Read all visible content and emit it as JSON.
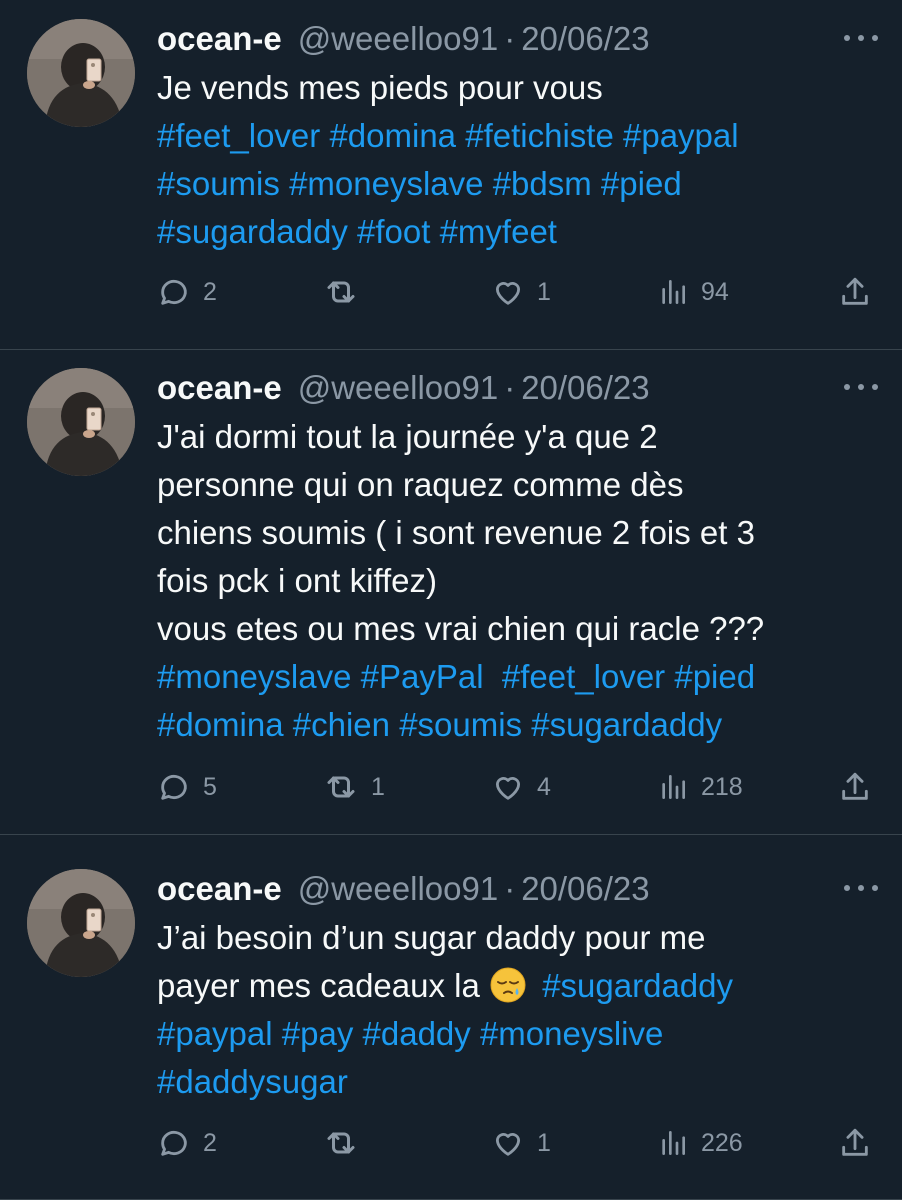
{
  "colors": {
    "background": "#15202b",
    "text": "#f7f9f9",
    "muted": "#8b98a5",
    "link": "#1d9bf0",
    "divider": "#38444d"
  },
  "tweets": [
    {
      "name": "ocean-e",
      "handle": "@weeelloo91",
      "separator": "·",
      "date": "20/06/23",
      "avatar_icon": "profile-photo-mirror-selfie",
      "lines": [
        [
          {
            "t": "Je vends mes pieds pour vous",
            "tag": false
          }
        ],
        [
          {
            "t": "#feet_lover",
            "tag": true
          },
          {
            "t": " ",
            "tag": false
          },
          {
            "t": "#domina",
            "tag": true
          },
          {
            "t": " ",
            "tag": false
          },
          {
            "t": "#fetichiste",
            "tag": true
          },
          {
            "t": " ",
            "tag": false
          },
          {
            "t": "#paypal",
            "tag": true
          }
        ],
        [
          {
            "t": "#soumis",
            "tag": true
          },
          {
            "t": " ",
            "tag": false
          },
          {
            "t": "#moneyslave",
            "tag": true
          },
          {
            "t": " ",
            "tag": false
          },
          {
            "t": "#bdsm",
            "tag": true
          },
          {
            "t": " ",
            "tag": false
          },
          {
            "t": "#pied",
            "tag": true
          }
        ],
        [
          {
            "t": "#sugardaddy",
            "tag": true
          },
          {
            "t": " ",
            "tag": false
          },
          {
            "t": "#foot",
            "tag": true
          },
          {
            "t": " ",
            "tag": false
          },
          {
            "t": "#myfeet",
            "tag": true
          }
        ]
      ],
      "replies": "2",
      "retweets": "",
      "likes": "1",
      "views": "94"
    },
    {
      "name": "ocean-e",
      "handle": "@weeelloo91",
      "separator": "·",
      "date": "20/06/23",
      "avatar_icon": "profile-photo-mirror-selfie",
      "lines": [
        [
          {
            "t": "J'ai dormi tout la journée y'a que 2",
            "tag": false
          }
        ],
        [
          {
            "t": "personne qui on raquez comme dès",
            "tag": false
          }
        ],
        [
          {
            "t": "chiens soumis ( i sont revenue 2 fois et 3",
            "tag": false
          }
        ],
        [
          {
            "t": "fois pck i ont kiffez)",
            "tag": false
          }
        ],
        [
          {
            "t": "vous etes ou mes vrai chien qui racle ???",
            "tag": false
          }
        ],
        [
          {
            "t": "#moneyslave",
            "tag": true
          },
          {
            "t": " ",
            "tag": false
          },
          {
            "t": "#PayPal",
            "tag": true
          },
          {
            "t": "  ",
            "tag": false
          },
          {
            "t": "#feet_lover",
            "tag": true
          },
          {
            "t": " ",
            "tag": false
          },
          {
            "t": "#pied",
            "tag": true
          }
        ],
        [
          {
            "t": "#domina",
            "tag": true
          },
          {
            "t": " ",
            "tag": false
          },
          {
            "t": "#chien",
            "tag": true
          },
          {
            "t": " ",
            "tag": false
          },
          {
            "t": "#soumis",
            "tag": true
          },
          {
            "t": " ",
            "tag": false
          },
          {
            "t": "#sugardaddy",
            "tag": true
          }
        ]
      ],
      "replies": "5",
      "retweets": "1",
      "likes": "4",
      "views": "218"
    },
    {
      "name": "ocean-e",
      "handle": "@weeelloo91",
      "separator": "·",
      "date": "20/06/23",
      "avatar_icon": "profile-photo-mirror-selfie",
      "lines": [
        [
          {
            "t": "J’ai besoin d’un sugar daddy pour me",
            "tag": false
          }
        ],
        [
          {
            "t": "payer mes cadeaux la ",
            "tag": false
          },
          {
            "emoji": "sleepy-face-emoji"
          },
          {
            "t": " ",
            "tag": false
          },
          {
            "t": "#sugardaddy",
            "tag": true
          }
        ],
        [
          {
            "t": "#paypal",
            "tag": true
          },
          {
            "t": " ",
            "tag": false
          },
          {
            "t": "#pay",
            "tag": true
          },
          {
            "t": " ",
            "tag": false
          },
          {
            "t": "#daddy",
            "tag": true
          },
          {
            "t": " ",
            "tag": false
          },
          {
            "t": "#moneyslive",
            "tag": true
          }
        ],
        [
          {
            "t": "#daddysugar",
            "tag": true
          }
        ]
      ],
      "replies": "2",
      "retweets": "",
      "likes": "1",
      "views": "226"
    }
  ],
  "icons": {
    "reply": "reply-icon",
    "retweet": "retweet-icon",
    "like": "heart-icon",
    "views": "views-icon",
    "share": "share-icon",
    "more": "more-icon"
  }
}
